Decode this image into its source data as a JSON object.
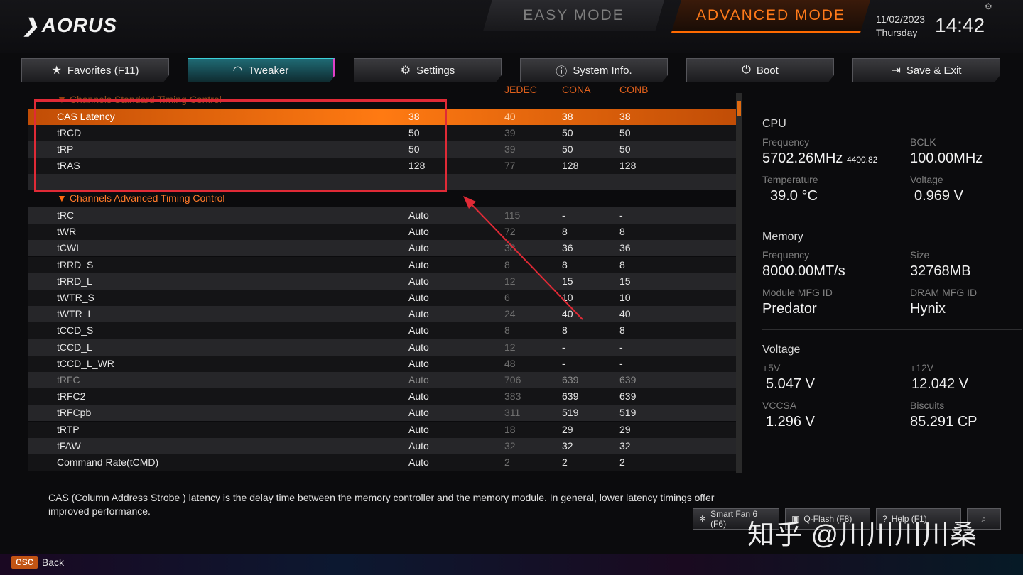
{
  "header": {
    "logo": "AORUS",
    "easy_mode": "EASY MODE",
    "advanced_mode": "ADVANCED MODE",
    "date": "11/02/2023",
    "day": "Thursday",
    "time": "14:42"
  },
  "tabs": [
    {
      "label": "Favorites (F11)",
      "icon": "star-icon"
    },
    {
      "label": "Tweaker",
      "icon": "speedometer-icon"
    },
    {
      "label": "Settings",
      "icon": "gear-icon"
    },
    {
      "label": "System Info.",
      "icon": "info-icon"
    },
    {
      "label": "Boot",
      "icon": "power-icon"
    },
    {
      "label": "Save & Exit",
      "icon": "exit-icon"
    }
  ],
  "columns": {
    "jedec": "JEDEC",
    "cona": "CONA",
    "conb": "CONB"
  },
  "standard_section": "Channels Standard Timing Control",
  "standard_rows": [
    {
      "name": "CAS Latency",
      "value": "38",
      "jedec": "40",
      "cona": "38",
      "conb": "38"
    },
    {
      "name": "tRCD",
      "value": "50",
      "jedec": "39",
      "cona": "50",
      "conb": "50"
    },
    {
      "name": "tRP",
      "value": "50",
      "jedec": "39",
      "cona": "50",
      "conb": "50"
    },
    {
      "name": "tRAS",
      "value": "128",
      "jedec": "77",
      "cona": "128",
      "conb": "128"
    }
  ],
  "advanced_section": "Channels Advanced Timing Control",
  "advanced_rows": [
    {
      "name": "tRC",
      "value": "Auto",
      "jedec": "115",
      "cona": "-",
      "conb": "-"
    },
    {
      "name": "tWR",
      "value": "Auto",
      "jedec": "72",
      "cona": "8",
      "conb": "8"
    },
    {
      "name": "tCWL",
      "value": "Auto",
      "jedec": "38",
      "cona": "36",
      "conb": "36"
    },
    {
      "name": "tRRD_S",
      "value": "Auto",
      "jedec": "8",
      "cona": "8",
      "conb": "8"
    },
    {
      "name": "tRRD_L",
      "value": "Auto",
      "jedec": "12",
      "cona": "15",
      "conb": "15"
    },
    {
      "name": "tWTR_S",
      "value": "Auto",
      "jedec": "6",
      "cona": "10",
      "conb": "10"
    },
    {
      "name": "tWTR_L",
      "value": "Auto",
      "jedec": "24",
      "cona": "40",
      "conb": "40"
    },
    {
      "name": "tCCD_S",
      "value": "Auto",
      "jedec": "8",
      "cona": "8",
      "conb": "8"
    },
    {
      "name": "tCCD_L",
      "value": "Auto",
      "jedec": "12",
      "cona": "-",
      "conb": "-"
    },
    {
      "name": "tCCD_L_WR",
      "value": "Auto",
      "jedec": "48",
      "cona": "-",
      "conb": "-"
    },
    {
      "name": "tRFC",
      "value": "Auto",
      "jedec": "706",
      "cona": "639",
      "conb": "639"
    },
    {
      "name": "tRFC2",
      "value": "Auto",
      "jedec": "383",
      "cona": "639",
      "conb": "639"
    },
    {
      "name": "tRFCpb",
      "value": "Auto",
      "jedec": "311",
      "cona": "519",
      "conb": "519"
    },
    {
      "name": "tRTP",
      "value": "Auto",
      "jedec": "18",
      "cona": "29",
      "conb": "29"
    },
    {
      "name": "tFAW",
      "value": "Auto",
      "jedec": "32",
      "cona": "32",
      "conb": "32"
    },
    {
      "name": "Command Rate(tCMD)",
      "value": "Auto",
      "jedec": "2",
      "cona": "2",
      "conb": "2"
    }
  ],
  "cpu": {
    "title": "CPU",
    "freq_label": "Frequency",
    "freq": "5702.26MHz",
    "freq_sub": "4400.82",
    "bclk_label": "BCLK",
    "bclk": "100.00MHz",
    "temp_label": "Temperature",
    "temp": "39.0 °C",
    "volt_label": "Voltage",
    "volt": "0.969 V"
  },
  "memory": {
    "title": "Memory",
    "freq_label": "Frequency",
    "freq": "8000.00MT/s",
    "size_label": "Size",
    "size": "32768MB",
    "module_label": "Module MFG ID",
    "module": "Predator",
    "dram_label": "DRAM MFG ID",
    "dram": "Hynix"
  },
  "voltage": {
    "title": "Voltage",
    "v5_label": "+5V",
    "v5": "5.047 V",
    "v12_label": "+12V",
    "v12": "12.042 V",
    "vccsa_label": "VCCSA",
    "vccsa": "1.296 V",
    "biscuits_label": "Biscuits",
    "biscuits": "85.291 CP"
  },
  "description": "CAS (Column Address Strobe ) latency is the delay time between the memory controller and the memory module. In general, lower latency timings offer improved performance.",
  "bottom_buttons": {
    "smart_fan": "Smart Fan 6 (F6)",
    "qflash": "Q-Flash (F8)",
    "help": "Help (F1)"
  },
  "footer": {
    "esc": "esc",
    "back": "Back"
  },
  "watermark": "知乎 @川川川川桑",
  "colors": {
    "accent": "#ff7a12",
    "highlight_box": "#e02a36",
    "tab_active": "#1f6a74"
  }
}
